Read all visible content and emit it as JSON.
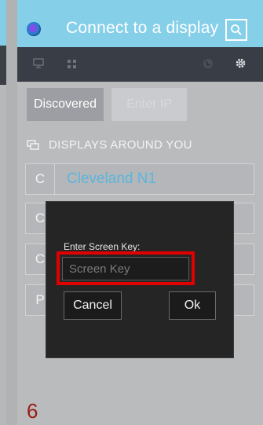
{
  "header": {
    "title": "Connect to a display"
  },
  "tabs": [
    {
      "label": "Discovered"
    },
    {
      "label": "Enter IP"
    }
  ],
  "section": {
    "title": "DISPLAYS AROUND YOU"
  },
  "displays": [
    {
      "letter": "C",
      "name": "Cleveland N1"
    },
    {
      "letter": "C",
      "name": ""
    },
    {
      "letter": "C",
      "name": ""
    },
    {
      "letter": "P",
      "name": ""
    }
  ],
  "dialog": {
    "label": "Enter Screen Key:",
    "input_placeholder": "Screen Key",
    "input_value": "",
    "cancel_label": "Cancel",
    "ok_label": "Ok"
  },
  "page_number": "6",
  "colors": {
    "header": "#85cfe9",
    "highlight": "#e00000",
    "accent_text": "#5ab6dc"
  }
}
